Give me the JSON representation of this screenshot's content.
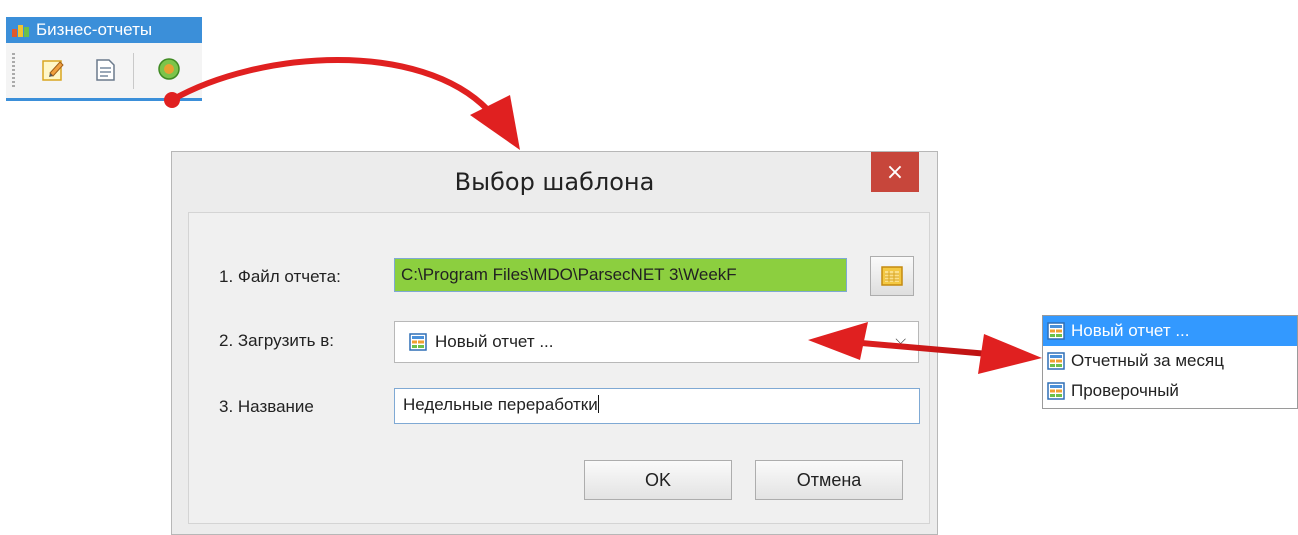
{
  "mini_window": {
    "title": "Бизнес-отчеты",
    "toolbar_icons": [
      "edit-icon",
      "document-icon",
      "run-report-icon"
    ]
  },
  "dialog": {
    "title": "Выбор шаблона",
    "close_label": "×",
    "file_label": "1. Файл отчета:",
    "file_value": "C:\\Program Files\\MDO\\ParsecNET 3\\WeekF",
    "load_label": "2. Загрузить в:",
    "load_value": "Новый отчет ...",
    "name_label": "3. Название",
    "name_value": "Недельные переработки",
    "ok_label": "OK",
    "cancel_label": "Отмена"
  },
  "dropdown": {
    "items": [
      {
        "label": "Новый отчет ...",
        "selected": true
      },
      {
        "label": "Отчетный за месяц",
        "selected": false
      },
      {
        "label": "Проверочный",
        "selected": false
      }
    ]
  },
  "colors": {
    "accent": "#3b8fd9",
    "close_red": "#c7463b",
    "file_field_green": "#8ccf3f",
    "selection_blue": "#3399ff",
    "arrow_red": "#e02020"
  }
}
